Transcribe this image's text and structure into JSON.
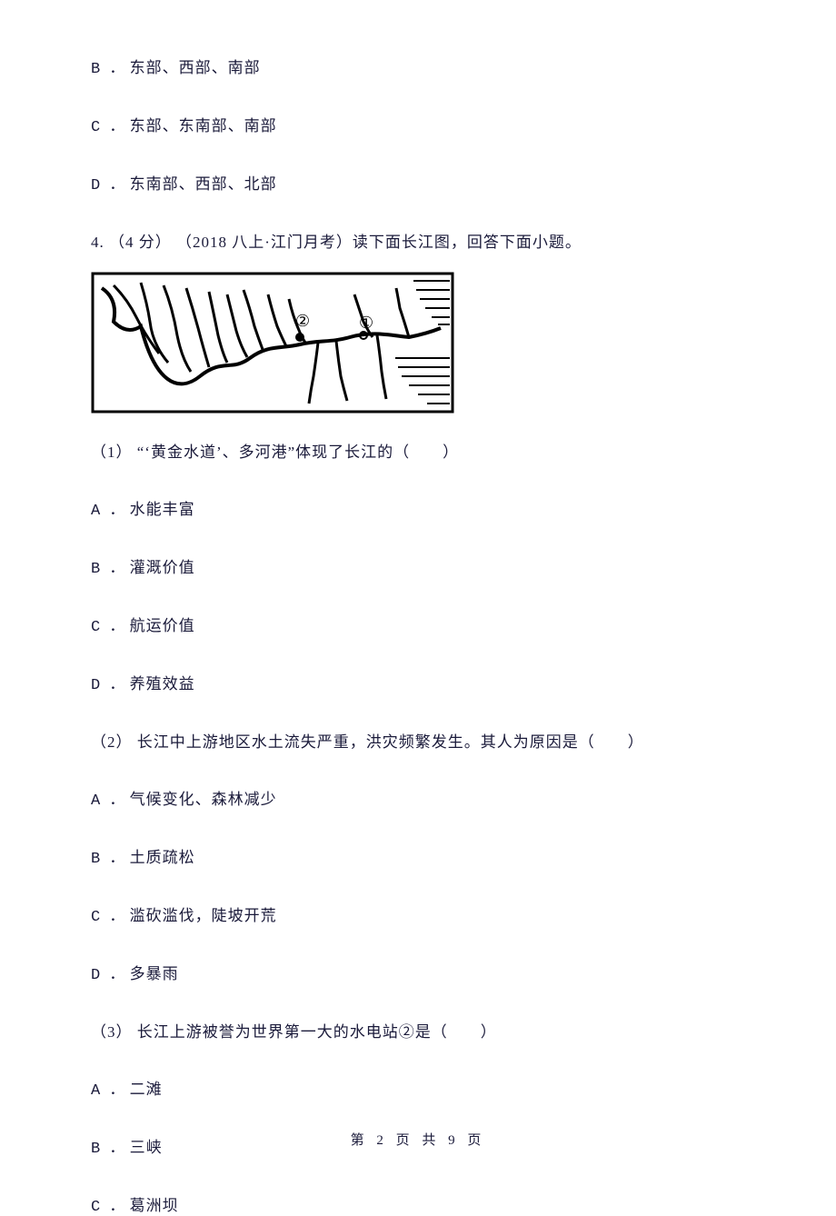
{
  "options_prev": {
    "b": "东部、西部、南部",
    "c": "东部、东南部、南部",
    "d": "东南部、西部、北部"
  },
  "q4": {
    "stem": "4. （4 分） （2018 八上·江门月考）读下面长江图，回答下面小题。",
    "sub1": {
      "stem": "（1） “‘黄金水道’、多河港”体现了长江的（　　）",
      "a": "水能丰富",
      "b": "灌溉价值",
      "c": "航运价值",
      "d": "养殖效益"
    },
    "sub2": {
      "stem": "（2） 长江中上游地区水土流失严重，洪灾频繁发生。其人为原因是（　　）",
      "a": "气候变化、森林减少",
      "b": "土质疏松",
      "c": "滥砍滥伐，陡坡开荒",
      "d": "多暴雨"
    },
    "sub3": {
      "stem": "（3） 长江上游被誉为世界第一大的水电站②是（　　）",
      "a": "二滩",
      "b": "三峡",
      "c": "葛洲坝"
    }
  },
  "labels": {
    "A": "A ．",
    "B": "B ．",
    "C": "C ．",
    "D": "D ．"
  },
  "map": {
    "marker1": "①",
    "marker2": "②"
  },
  "footer": {
    "text": "第 2 页 共 9 页"
  }
}
